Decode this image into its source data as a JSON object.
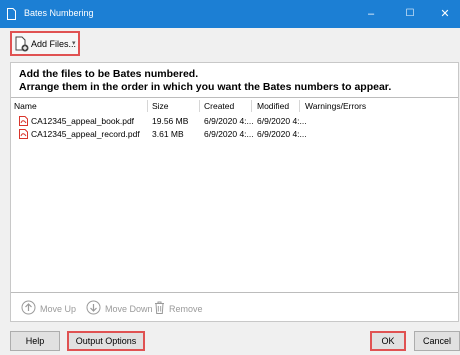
{
  "window": {
    "title": "Bates Numbering",
    "minimize": "–",
    "maximize": "☐",
    "close": "✕"
  },
  "toolbar": {
    "add_files_label": "Add Files...",
    "add_files_caret": "▾"
  },
  "instructions": {
    "line1": "Add the files to be Bates numbered.",
    "line2": "Arrange them in the order in which you want the Bates numbers to appear."
  },
  "table": {
    "columns": [
      "Name",
      "Size",
      "Created",
      "Modified",
      "Warnings/Errors"
    ],
    "rows": [
      {
        "name": "CA12345_appeal_book.pdf",
        "size": "19.56 MB",
        "created": "6/9/2020 4:...",
        "modified": "6/9/2020 4:...",
        "warnings": ""
      },
      {
        "name": "CA12345_appeal_record.pdf",
        "size": "3.61 MB",
        "created": "6/9/2020 4:...",
        "modified": "6/9/2020 4:...",
        "warnings": ""
      }
    ]
  },
  "actions": {
    "move_up": "Move Up",
    "move_down": "Move Down",
    "remove": "Remove"
  },
  "buttons": {
    "help": "Help",
    "output_options": "Output Options",
    "ok": "OK",
    "cancel": "Cancel"
  },
  "colors": {
    "titlebar": "#1c7fd4",
    "highlight": "#e05252",
    "pdf_icon": "#d9342b"
  }
}
